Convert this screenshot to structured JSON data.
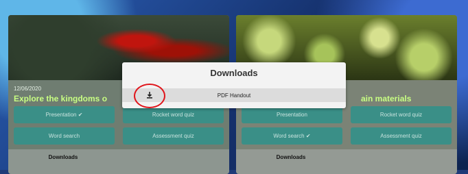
{
  "left_card": {
    "date": "12/06/2020",
    "title": "Explore the kingdoms o",
    "buttons": [
      "Presentation ✔",
      "Rocket word quiz",
      "Word search",
      "Assessment quiz"
    ],
    "downloads_label": "Downloads"
  },
  "right_card": {
    "title": "ain materials",
    "buttons": [
      "Presentation",
      "Rocket word quiz",
      "Word search ✔",
      "Assessment quiz"
    ],
    "downloads_label": "Downloads"
  },
  "modal": {
    "title": "Downloads",
    "rows": [
      {
        "label": "PDF Handout",
        "icon": "download-icon"
      }
    ]
  },
  "colors": {
    "accent_button": "#3a8f87",
    "title_green": "#c8ff83",
    "highlight_red": "#e0151b"
  }
}
